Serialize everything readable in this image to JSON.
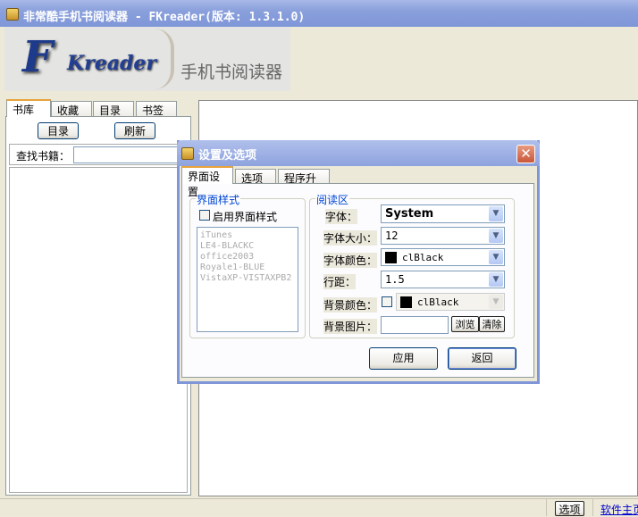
{
  "window": {
    "title": "非常酷手机书阅读器 - FKreader(版本: 1.3.1.0)"
  },
  "logo": {
    "letter": "F",
    "wordmark": "Kreader",
    "tagline": "手机书阅读器"
  },
  "left_panel": {
    "tabs": [
      "书库",
      "收藏",
      "目录",
      "书签"
    ],
    "catalog_button": "目录",
    "refresh_button": "刷新",
    "search_label": "查找书籍：",
    "search_value": ""
  },
  "statusbar": {
    "options_button": "选项",
    "homepage_link": "软件主页"
  },
  "dialog": {
    "title": "设置及选项",
    "tabs": [
      "界面设置",
      "选项",
      "程序升级"
    ],
    "style_group": {
      "title": "界面样式",
      "enable_label": "启用界面样式",
      "enabled": false,
      "skins": [
        "iTunes",
        "LE4-BLACKC",
        "office2003",
        "Royale1-BLUE",
        "VistaXP-VISTAXPB2"
      ]
    },
    "reading_group": {
      "title": "阅读区",
      "font_label": "字体：",
      "font_value": "System",
      "size_label": "字体大小：",
      "size_value": "12",
      "color_label": "字体颜色：",
      "color_value": "clBlack",
      "spacing_label": "行距：",
      "spacing_value": "1.5",
      "bg_color_label": "背景颜色：",
      "bg_color_value": "clBlack",
      "bg_color_enabled": false,
      "bg_image_label": "背景图片：",
      "bg_image_value": "",
      "browse_button": "浏览",
      "clear_button": "清除"
    },
    "apply_button": "应用",
    "back_button": "返回"
  }
}
